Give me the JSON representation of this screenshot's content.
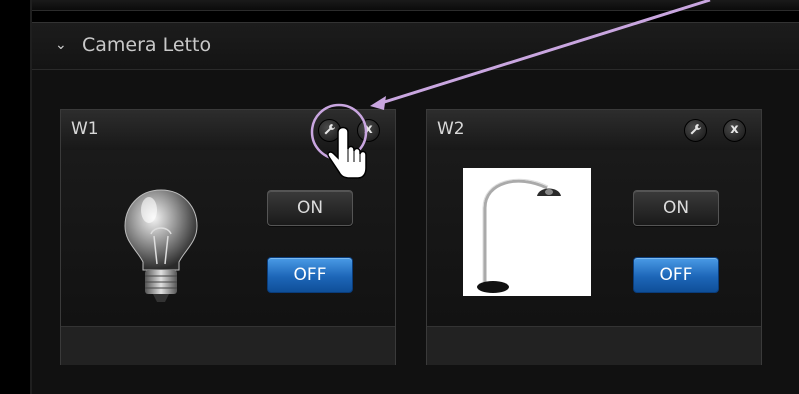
{
  "section": {
    "title": "Camera Letto",
    "chevron_icon": "chevron-down-icon"
  },
  "widgets": [
    {
      "title": "W1",
      "settings_icon": "wrench-icon",
      "close_label": "x",
      "image": "light-bulb-icon",
      "on_label": "ON",
      "off_label": "OFF"
    },
    {
      "title": "W2",
      "settings_icon": "wrench-icon",
      "close_label": "x",
      "image": "floor-lamp-image",
      "on_label": "ON",
      "off_label": "OFF"
    }
  ],
  "colors": {
    "background": "#000000",
    "panel": "#111111",
    "off_button": "#1d66b8",
    "annotation": "#c9a6e0"
  },
  "annotation": {
    "type": "arrow-callout",
    "target": "W1 settings button",
    "cursor": "hand-pointer-icon"
  }
}
